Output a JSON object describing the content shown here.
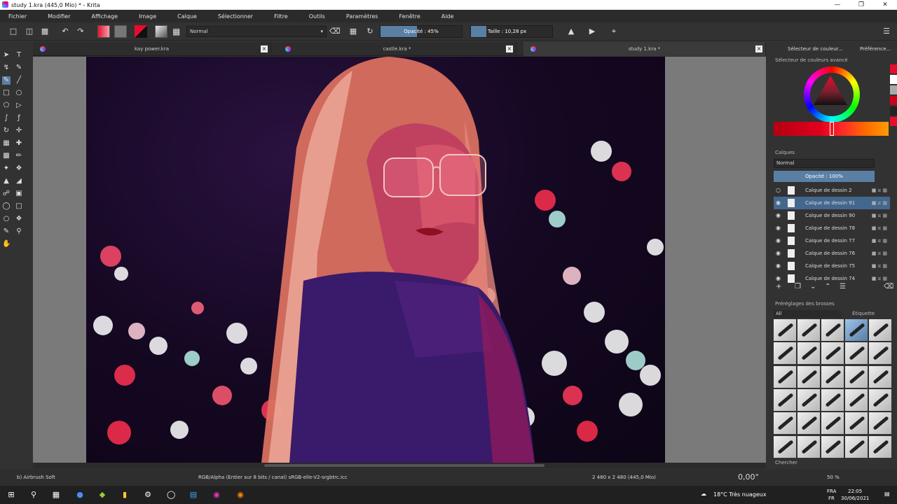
{
  "window": {
    "title": "study 1.kra (445,0 Mio)  * - Krita"
  },
  "menu": [
    "Fichier",
    "Modifier",
    "Affichage",
    "Image",
    "Calque",
    "Sélectionner",
    "Filtre",
    "Outils",
    "Paramètres",
    "Fenêtre",
    "Aide"
  ],
  "toolbar": {
    "blend_mode": "Normal",
    "opacity": "Opacité : 45%",
    "opacity_fraction": 0.45,
    "size": "Taille : 10,28 px"
  },
  "doc_tabs": [
    "kay power.kra",
    "castle.kra *",
    "study 1.kra *"
  ],
  "dockers": {
    "tab_selector": "Sélecteur de couleur...",
    "tab_prefs": "Préférence...",
    "color_title": "Sélecteur de couleurs avancé"
  },
  "layers": {
    "title": "Calques",
    "blend": "Normal",
    "opacity": "Opacité : 100%",
    "items": [
      "Calque de dessin 2",
      "Calque de dessin 91",
      "Calque de dessin 90",
      "Calque de dessin 78",
      "Calque de dessin 77",
      "Calque de dessin 76",
      "Calque de dessin 75",
      "Calque de dessin 74"
    ]
  },
  "brush_presets": {
    "title": "Préréglages des brosses",
    "filter": "All",
    "tag": "Étiquette",
    "search": "Chercher"
  },
  "status": {
    "brush": "b) Airbrush Soft",
    "colorspace": "RGB/Alpha (Entier sur 8 bits / canal)  sRGB-elle-V2-srgbtrc.icc",
    "dimensions": "2 480 x 2 480 (445,0 Mio)",
    "rotation": "0,00°",
    "zoom": "50 %"
  },
  "taskbar": {
    "weather": "18°C  Très nuageux",
    "lang": "FRA",
    "lang2": "FR",
    "time": "22:05",
    "date": "30/06/2021"
  },
  "colors": {
    "accent": "#5a7fa5",
    "fg": "#e80c2c",
    "bg": "#323232"
  }
}
